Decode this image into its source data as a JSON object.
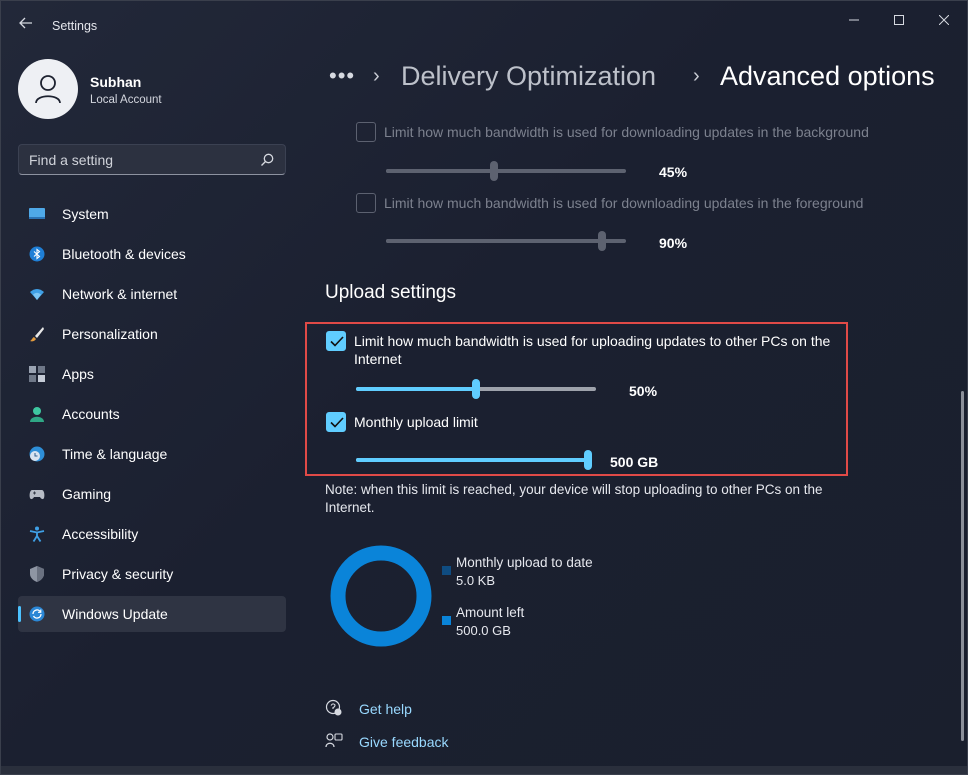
{
  "window": {
    "title": "Settings"
  },
  "user": {
    "name": "Subhan",
    "account_type": "Local Account"
  },
  "search": {
    "placeholder": "Find a setting"
  },
  "sidebar": {
    "items": [
      {
        "label": "System",
        "icon": "monitor-icon"
      },
      {
        "label": "Bluetooth & devices",
        "icon": "bluetooth-icon"
      },
      {
        "label": "Network & internet",
        "icon": "wifi-icon"
      },
      {
        "label": "Personalization",
        "icon": "brush-icon"
      },
      {
        "label": "Apps",
        "icon": "apps-icon"
      },
      {
        "label": "Accounts",
        "icon": "person-icon"
      },
      {
        "label": "Time & language",
        "icon": "globe-clock-icon"
      },
      {
        "label": "Gaming",
        "icon": "gamepad-icon"
      },
      {
        "label": "Accessibility",
        "icon": "accessibility-icon"
      },
      {
        "label": "Privacy & security",
        "icon": "shield-icon"
      },
      {
        "label": "Windows Update",
        "icon": "sync-icon",
        "active": true
      }
    ]
  },
  "breadcrumb": {
    "more": "•••",
    "parent": "Delivery Optimization",
    "current": "Advanced options"
  },
  "download": {
    "background": {
      "label": "Limit how much bandwidth is used for downloading updates in the background",
      "checked": false,
      "value_label": "45%",
      "value": 0.45
    },
    "foreground": {
      "label": "Limit how much bandwidth is used for downloading updates in the foreground",
      "checked": false,
      "value_label": "90%",
      "value": 0.9
    }
  },
  "upload": {
    "title": "Upload settings",
    "bandwidth": {
      "label_line1": "Limit how much bandwidth is used for uploading updates to other PCs on the",
      "label_line2": "Internet",
      "checked": true,
      "value_label": "50%",
      "value": 0.5
    },
    "monthly": {
      "label": "Monthly upload limit",
      "checked": true,
      "value_label": "500 GB",
      "value": 1.0
    },
    "note_line1": "Note: when this limit is reached, your device will stop uploading to other PCs on the",
    "note_line2": "Internet."
  },
  "usage": {
    "uploaded": {
      "label": "Monthly upload to date",
      "value": "5.0 KB",
      "color": "#0f4c81"
    },
    "left": {
      "label": "Amount left",
      "value": "500.0 GB",
      "color": "#0a84d9"
    }
  },
  "help": {
    "get_help": "Get help",
    "give_feedback": "Give feedback"
  },
  "colors": {
    "accent": "#60cdff",
    "highlight": "#e04a47",
    "donut": "#0a84d9"
  }
}
